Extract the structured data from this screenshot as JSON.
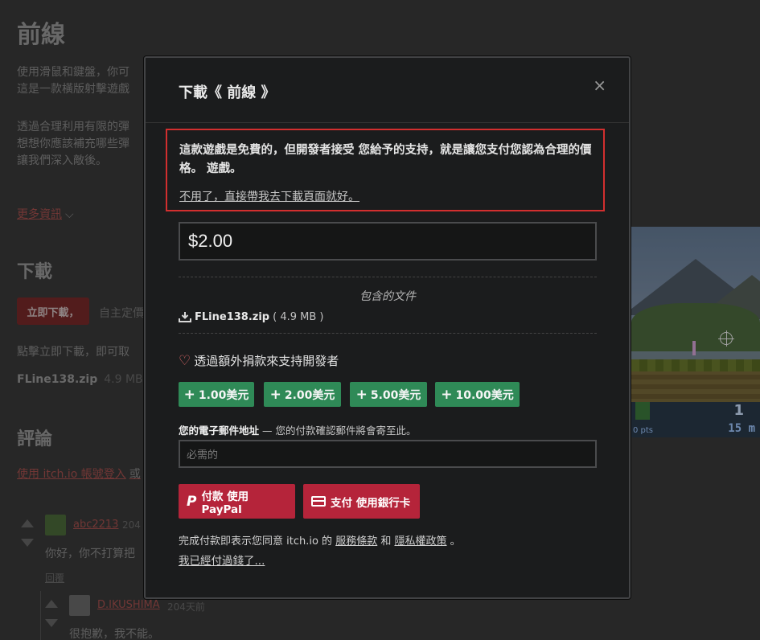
{
  "background": {
    "title": "前線",
    "desc_lines_1": [
      "使用滑鼠和鍵盤，你可",
      "這是一款橫版射擊遊戲"
    ],
    "desc_lines_2": [
      "透過合理利用有限的彈",
      "想想你應該補充哪些彈",
      "讓我們深入敵後。"
    ],
    "more_info": "更多資訊",
    "download_heading": "下載",
    "download_button": "立即下載，",
    "download_alt": "自主定價",
    "click_text": "點擊立即下載，即可取",
    "file_name": "FLine138.zip",
    "file_size": "4.9 MB",
    "comments_heading": "評論",
    "login_link": "使用 itch.io 帳號登入",
    "login_rest": "或",
    "comments": [
      {
        "user": "abc2213",
        "when": "204",
        "text": "你好，你不打算把",
        "reply": "回覆"
      },
      {
        "user": "D.IKUSHIMA",
        "when": "204天前",
        "text": "很抱歉，我不能。"
      }
    ],
    "game_hud": {
      "distance": "15 m",
      "number": "1",
      "points": "0 pts"
    }
  },
  "modal": {
    "title": "下載《 前線 》",
    "close": "×",
    "notice": {
      "message": "這款遊戲是免費的，但開發者接受 您給予的支持，就是讓您支付您認為合理的價格。 遊戲。",
      "skip_link": "不用了，直接帶我去下載頁面就好。"
    },
    "price_value": "$2.00",
    "included_label": "包含的文件",
    "file": {
      "name": "FLine138.zip",
      "size": "( 4.9 MB )"
    },
    "donate_label": "透過額外捐款來支持開發者",
    "amounts": [
      "1.00美元",
      "2.00美元",
      "5.00美元",
      "10.00美元"
    ],
    "email": {
      "label": "您的電子郵件地址",
      "hint": " — 您的付款確認郵件將會寄至此。",
      "placeholder": "必需的"
    },
    "paypal_button": "付款 使用PayPal",
    "card_button": "支付 使用銀行卡",
    "terms": {
      "prefix": "完成付款即表示您同意 itch.io 的 ",
      "tos": "服務條款",
      "and": " 和 ",
      "privacy": "隱私權政策",
      "suffix": " 。"
    },
    "already_paid": "我已經付過錢了..."
  },
  "colors": {
    "accent_red": "#d22f2f",
    "donate_green": "#2f8a57",
    "pay_red": "#b5243a"
  }
}
